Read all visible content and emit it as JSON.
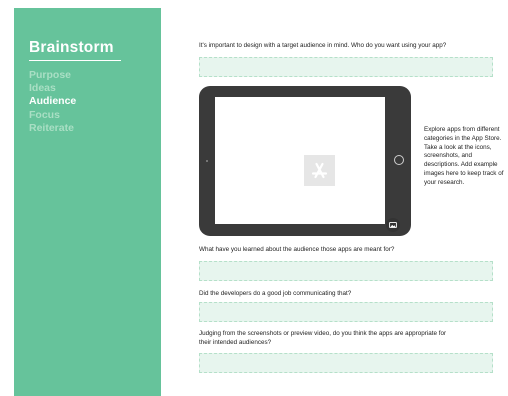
{
  "sidebar": {
    "title": "Brainstorm",
    "items": [
      {
        "label": "Purpose",
        "active": false
      },
      {
        "label": "Ideas",
        "active": false
      },
      {
        "label": "Audience",
        "active": true
      },
      {
        "label": "Focus",
        "active": false
      },
      {
        "label": "Reiterate",
        "active": false
      }
    ]
  },
  "main": {
    "q1": "It's important to design with a target audience in mind. Who do you want using your app?",
    "device_note": "Explore apps from different categories in the App Store. Take a look at the icons, screenshots, and descriptions. Add example images here to keep track of your research.",
    "q2": "What have you learned about the audience those apps are meant for?",
    "q3": "Did the developers do a good job communicating that?",
    "q4": "Judging from the screenshots or preview video, do you think the apps are appropriate for their intended audiences?"
  },
  "icons": {
    "placeholder": "app-store-icon",
    "add_image": "image-icon"
  },
  "colors": {
    "sidebar": "#66c39b",
    "sidebar_inactive": "#a9dfc4",
    "answer_fill": "#e7f5ee",
    "device": "#3a3a3a"
  }
}
